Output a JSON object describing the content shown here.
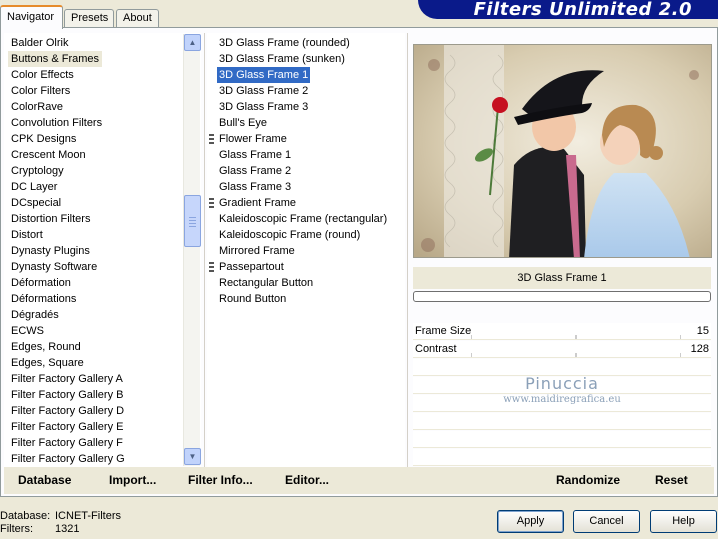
{
  "tabs": [
    {
      "label": "Navigator",
      "active": true
    },
    {
      "label": "Presets",
      "active": false
    },
    {
      "label": "About",
      "active": false
    }
  ],
  "banner_title": "Filters Unlimited 2.0",
  "categories": [
    "Balder Olrik",
    "Buttons & Frames",
    "Color Effects",
    "Color Filters",
    "ColorRave",
    "Convolution Filters",
    "CPK Designs",
    "Crescent Moon",
    "Cryptology",
    "DC Layer",
    "DCspecial",
    "Distortion Filters",
    "Distort",
    "Dynasty Plugins",
    "Dynasty Software",
    "Déformation",
    "Déformations",
    "Dégradés",
    "ECWS",
    "Edges, Round",
    "Edges, Square",
    "Filter Factory Gallery A",
    "Filter Factory Gallery B",
    "Filter Factory Gallery D",
    "Filter Factory Gallery E",
    "Filter Factory Gallery F",
    "Filter Factory Gallery G"
  ],
  "selected_category_index": 1,
  "filters": [
    {
      "label": "3D Glass Frame (rounded)",
      "group": false
    },
    {
      "label": "3D Glass Frame (sunken)",
      "group": false
    },
    {
      "label": "3D Glass Frame 1",
      "group": false
    },
    {
      "label": "3D Glass Frame 2",
      "group": false
    },
    {
      "label": "3D Glass Frame 3",
      "group": false
    },
    {
      "label": "Bull's Eye",
      "group": false
    },
    {
      "label": "Flower Frame",
      "group": true
    },
    {
      "label": "Glass Frame 1",
      "group": false
    },
    {
      "label": "Glass Frame 2",
      "group": false
    },
    {
      "label": "Glass Frame 3",
      "group": false
    },
    {
      "label": "Gradient Frame",
      "group": true
    },
    {
      "label": "Kaleidoscopic Frame (rectangular)",
      "group": false
    },
    {
      "label": "Kaleidoscopic Frame (round)",
      "group": false
    },
    {
      "label": "Mirrored Frame",
      "group": false
    },
    {
      "label": "Passepartout",
      "group": true
    },
    {
      "label": "Rectangular Button",
      "group": false
    },
    {
      "label": "Round Button",
      "group": false
    }
  ],
  "selected_filter_index": 2,
  "preview": {
    "filter_name": "3D Glass Frame 1",
    "progress": 0
  },
  "params": [
    {
      "name": "Frame Size",
      "value": "15"
    },
    {
      "name": "Contrast",
      "value": "128"
    }
  ],
  "watermark": {
    "line1": "Pinuccia",
    "line2": "www.maidiregrafica.eu"
  },
  "bottom_buttons": {
    "database": "Database",
    "import": "Import...",
    "filter_info": "Filter Info...",
    "editor": "Editor...",
    "randomize": "Randomize",
    "reset": "Reset"
  },
  "info": {
    "database_label": "Database:",
    "database_value": "ICNET-Filters",
    "filters_label": "Filters:",
    "filters_value": "1321"
  },
  "buttons": {
    "apply": "Apply",
    "cancel": "Cancel",
    "help": "Help"
  },
  "colors": {
    "selection": "#316ac5",
    "banner": "#0a1a8a",
    "tab_accent": "#e68b2c"
  }
}
